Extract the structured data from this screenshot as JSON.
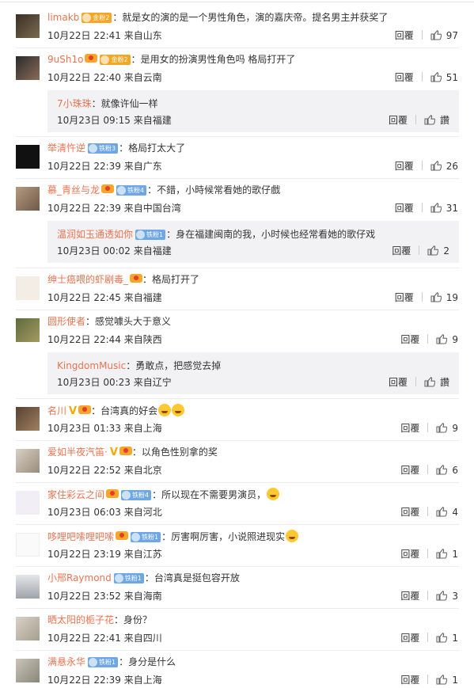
{
  "ui": {
    "reply_label": "回覆",
    "accent": "#eb7350"
  },
  "comments": [
    {
      "user": "limakb",
      "badge": "金粉2",
      "text": "就是女的演的是一个男性角色，演的嘉庆帝。提名男主并获奖了",
      "time": "10月22日 22:41 来自山东",
      "likes": "97"
    },
    {
      "user": "9uSh1o",
      "badge": "金粉2",
      "text": "是用女的扮演男性角色吗 格局打开了",
      "time": "10月22日 22:40 来自云南",
      "likes": "51",
      "replies": [
        {
          "user": "7小珠珠",
          "text": "就像许仙一样",
          "time": "10月23日 09:15 来自福建",
          "likes": "讚"
        }
      ]
    },
    {
      "user": "举清忤逆",
      "badge": "铁粉3",
      "text": "格局打太大了",
      "time": "10月22日 22:39 来自广东",
      "likes": "26"
    },
    {
      "user": "慕_青丝与龙",
      "badge": "铁粉4",
      "text": "不錯，小時候常看她的歌仔戲",
      "time": "10月22日 22:39 来自中国台湾",
      "likes": "31",
      "replies": [
        {
          "user": "温润如玉通透如你",
          "badge": "铁粉1",
          "text": "身在福建闽南的我，小时候也经常看她的歌仔戏",
          "time": "10月23日 00:02 来自福建",
          "likes": "2"
        }
      ]
    },
    {
      "user": "绅士癌喂的虾剧毒_",
      "text": "格局打开了",
      "time": "10月22日 22:45 来自福建",
      "likes": "19"
    },
    {
      "user": "圆形使者",
      "text": "感觉噱头大于意义",
      "time": "10月22日 22:44 来自陕西",
      "likes": "9",
      "replies": [
        {
          "user": "KingdomMusic",
          "text": "勇敢点，把感觉去掉",
          "time": "10月23日 00:23 来自辽宁",
          "likes": "讚"
        }
      ]
    },
    {
      "user": "名川",
      "text": "台湾真的好会",
      "time": "10月23日 01:33 来自上海",
      "likes": "9"
    },
    {
      "user": "爱如半夜汽笛·",
      "text": "以角色性别拿的奖",
      "time": "10月22日 22:52 来自北京",
      "likes": "6"
    },
    {
      "user": "家住彩云之间",
      "badge": "铁粉4",
      "text": "所以现在不需要男演员，",
      "time": "10月23日 06:03 来自河北",
      "likes": "4"
    },
    {
      "user": "哆哩吧嗦哩吧嗦",
      "badge": "铁粉1",
      "text": "厉害啊厉害，小说照进现实",
      "time": "10月22日 23:19 来自江苏",
      "likes": "1"
    },
    {
      "user": "小邢Raymond",
      "badge": "铁粉1",
      "text": "台湾真是挺包容开放",
      "time": "10月22日 23:52 来自海南",
      "likes": "3"
    },
    {
      "user": "晒太阳的栀子花",
      "text": "身份？",
      "time": "10月22日 22:41 来自四川",
      "likes": "1"
    },
    {
      "user": "满悬永华",
      "badge": "铁粉1",
      "text": "身分是什么",
      "time": "10月22日 22:39 来自上海",
      "likes": "1"
    }
  ]
}
